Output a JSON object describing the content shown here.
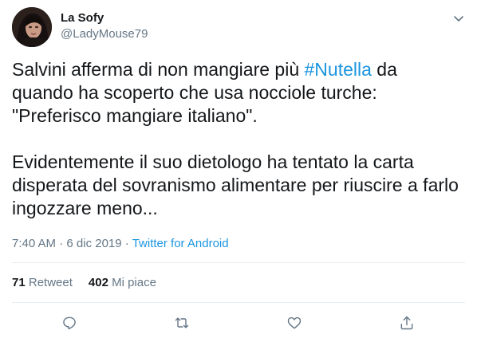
{
  "author": {
    "display_name": "La Sofy",
    "handle": "@LadyMouse79"
  },
  "tweet": {
    "text_before": "Salvini afferma di non mangiare più ",
    "hashtag": "#Nutella",
    "text_after": " da\nquando ha scoperto che usa nocciole turche:\n\"Preferisco mangiare italiano\".\n\nEvidentemente il suo dietologo ha tentato la carta\ndisperata del sovranismo alimentare per riuscire a farlo\ningozzare meno...",
    "time": "7:40 AM",
    "separator": "·",
    "date": "6 dic 2019",
    "source": "Twitter for Android"
  },
  "stats": {
    "retweets_count": "71",
    "retweets_label": "Retweet",
    "likes_count": "402",
    "likes_label": "Mi piace"
  },
  "actions": [
    "reply-icon",
    "retweet-icon",
    "like-icon",
    "share-icon"
  ],
  "colors": {
    "link": "#1b95e0",
    "secondary_text": "#657786",
    "primary_text": "#14171a",
    "divider": "#e6ecf0"
  }
}
